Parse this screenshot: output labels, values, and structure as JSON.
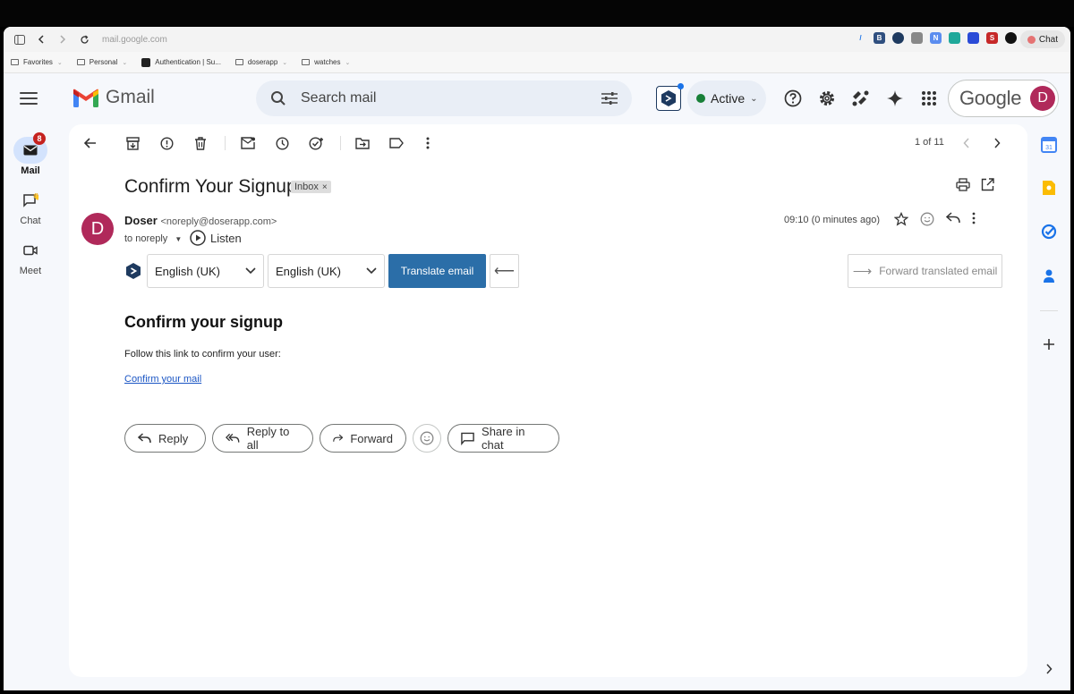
{
  "browser": {
    "url": "mail.google.com",
    "chat_label": "Chat",
    "bookmarks": [
      {
        "label": "Favorites",
        "type": "folder"
      },
      {
        "label": "Personal",
        "type": "folder"
      },
      {
        "label": "Authentication | Su...",
        "type": "site"
      },
      {
        "label": "doserapp",
        "type": "folder"
      },
      {
        "label": "watches",
        "type": "folder"
      }
    ]
  },
  "header": {
    "app_name": "Gmail",
    "search_placeholder": "Search mail",
    "status": "Active",
    "google_label": "Google",
    "avatar_letter": "D",
    "colors": {
      "status_dot": "#188038",
      "avatar": "#b0295a"
    }
  },
  "nav": {
    "mail": {
      "label": "Mail",
      "badge": "8"
    },
    "chat": {
      "label": "Chat"
    },
    "meet": {
      "label": "Meet"
    }
  },
  "toolbar": {
    "pager": "1 of 11"
  },
  "email": {
    "subject": "Confirm Your Signup",
    "label_tag": "Inbox",
    "sender_name": "Doser",
    "sender_email": "<noreply@doserapp.com>",
    "to_line": "to noreply",
    "listen_label": "Listen",
    "time": "09:10 (0 minutes ago)",
    "avatar_letter": "D",
    "body_heading": "Confirm your signup",
    "body_text": "Follow this link to confirm your user:",
    "body_link": "Confirm your mail"
  },
  "translate": {
    "source_lang": "English (UK)",
    "target_lang": "English (UK)",
    "translate_button": "Translate email",
    "forward_button": "Forward translated email"
  },
  "actions": {
    "reply": "Reply",
    "reply_all": "Reply to all",
    "forward": "Forward",
    "share": "Share in chat"
  }
}
